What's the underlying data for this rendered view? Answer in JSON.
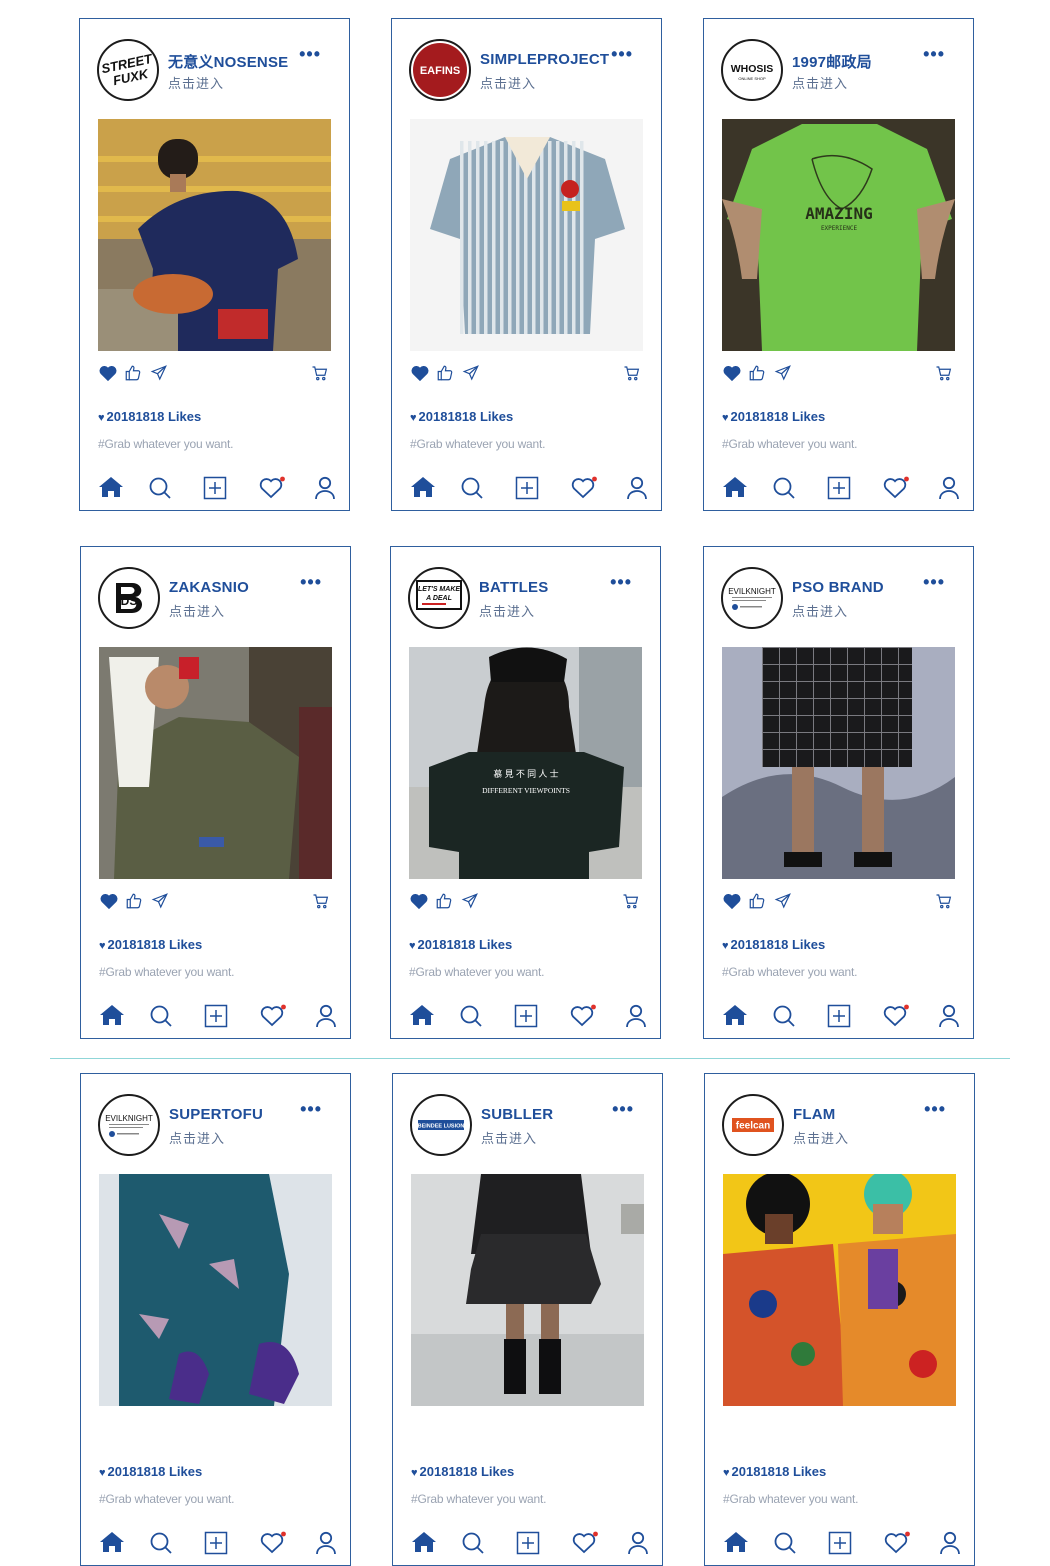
{
  "colors": {
    "accent": "#1f4e9a",
    "notification_dot": "#e0312b",
    "divider": "#8fd6d8"
  },
  "common": {
    "more_label": "•••",
    "enter_label": "点击进入",
    "likes_label": "20181818 Likes",
    "caption": "#Grab whatever you want."
  },
  "icons": {
    "post_actions": [
      "heart-icon",
      "thumbs-up-icon",
      "send-icon",
      "cart-icon"
    ],
    "tab_bar": [
      "home-icon",
      "search-icon",
      "add-icon",
      "activity-heart-icon",
      "profile-icon"
    ]
  },
  "posts": [
    {
      "brand": "无意义NOSENSE",
      "avatar_text": "STREET FUXK",
      "photo": "Man in navy t-shirt holding an orange cap"
    },
    {
      "brand": "SIMPLEPROJECT",
      "avatar_text": "EAFINS",
      "photo": "Striped short-sleeve shirt with red badge"
    },
    {
      "brand": "1997邮政局",
      "avatar_text": "WHOSIS",
      "avatar_subtext": "ONLINE SHOP",
      "photo": "Green t-shirt with AMAZING print",
      "photo_text": "AMAZING"
    },
    {
      "brand": "ZAKASNIO",
      "avatar_text": "DS",
      "photo": "Man in olive shirt with white towel drinking"
    },
    {
      "brand": "BATTLES",
      "avatar_text": "LET'S MAKE A DEAL",
      "photo": "Back view of long-haired person in black beanie and t-shirt",
      "photo_text": "DIFFERENT VIEWPOINTS"
    },
    {
      "brand": "PSO BRAND",
      "avatar_text": "EVILKNIGHT",
      "photo": "Checkered shorts on sand dunes"
    },
    {
      "brand": "SUPERTOFU",
      "avatar_text": "EVILKNIGHT",
      "photo": "Blue patterned shirt with purple gloves"
    },
    {
      "brand": "SUBLLER",
      "avatar_text": "BEINDEE LUSION",
      "photo": "Black cargo shorts and socks"
    },
    {
      "brand": "FLAM",
      "avatar_text": "feelcan",
      "photo": "Two models in colorful printed shirts on yellow background"
    }
  ]
}
